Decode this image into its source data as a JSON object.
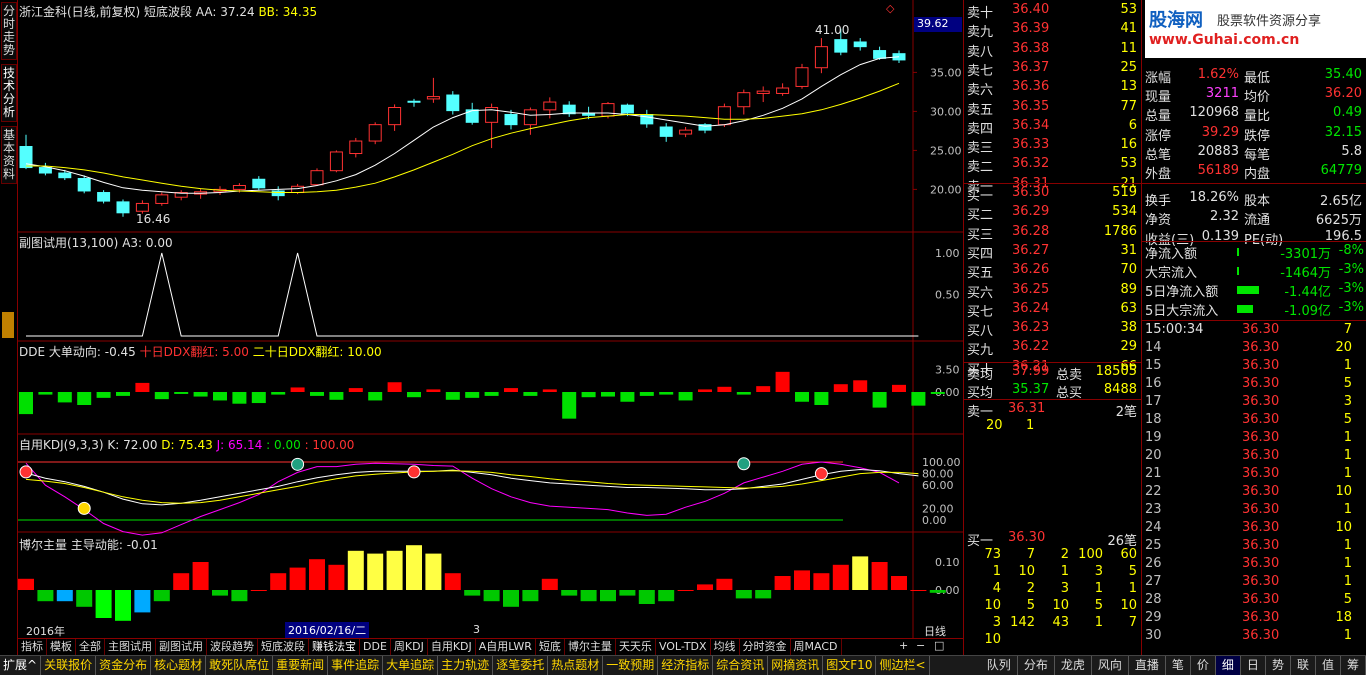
{
  "leftnav": [
    "分时走势",
    "技术分析",
    "基本资料"
  ],
  "main_title": {
    "stock": "浙江金科(日线,前复权)",
    "indicator": "短底波段",
    "aa": "AA: 37.24",
    "bb": "BB: 34.35"
  },
  "price_axis": [
    "35.00",
    "30.00",
    "25.00",
    "20.00"
  ],
  "price_marker": "39.62",
  "hi_label": "41.00",
  "lo_label": "16.46",
  "sub1": {
    "title": "副图试用(13,100)",
    "value": "A3: 0.00",
    "axis": [
      "1.00",
      "0.50"
    ]
  },
  "dde": {
    "title": "DDE 大单动向: -0.45",
    "t2": "十日DDX翻红: 5.00",
    "t3": "二十日DDX翻红: 10.00",
    "axis": [
      "3.50",
      "0.00"
    ]
  },
  "kdj": {
    "title": "自用KDJ(9,3,3)",
    "k": "K: 72.00",
    "d": "D: 75.43",
    "j": "J: 65.14",
    "z1": ": 0.00",
    "z2": ": 100.00",
    "axis": [
      "100.00",
      "80.00",
      "60.00",
      "20.00",
      "0.00"
    ]
  },
  "bor": {
    "title": "博尔主量",
    "value": "主导动能: -0.01",
    "axis": [
      "0.10",
      "0.00"
    ]
  },
  "dates": {
    "y": "2016年",
    "sel": "2016/02/16/二",
    "m": "3",
    "period": "日线"
  },
  "chart_data": {
    "type": "candlestick",
    "candles": [
      [
        25.5,
        27.0,
        22.6,
        22.8
      ],
      [
        22.8,
        23.4,
        21.8,
        22.1
      ],
      [
        22.1,
        22.5,
        21.2,
        21.5
      ],
      [
        21.4,
        21.8,
        19.5,
        19.8
      ],
      [
        19.6,
        19.9,
        18.2,
        18.5
      ],
      [
        18.4,
        18.7,
        16.5,
        17.0
      ],
      [
        17.2,
        18.6,
        16.9,
        18.2
      ],
      [
        18.2,
        19.6,
        17.9,
        19.3
      ],
      [
        19.0,
        19.9,
        18.6,
        19.6
      ],
      [
        19.4,
        20.1,
        18.8,
        19.7
      ],
      [
        19.7,
        20.4,
        19.3,
        20.0
      ],
      [
        20.0,
        20.8,
        19.6,
        20.5
      ],
      [
        21.3,
        21.7,
        19.9,
        20.2
      ],
      [
        19.8,
        20.4,
        18.6,
        19.2
      ],
      [
        19.6,
        20.7,
        19.4,
        20.4
      ],
      [
        20.6,
        22.7,
        20.5,
        22.4
      ],
      [
        22.4,
        25.0,
        22.2,
        24.8
      ],
      [
        24.6,
        26.6,
        24.1,
        26.2
      ],
      [
        26.2,
        28.6,
        25.8,
        28.3
      ],
      [
        28.3,
        30.9,
        27.5,
        30.5
      ],
      [
        31.3,
        31.6,
        30.6,
        31.2
      ],
      [
        31.6,
        34.3,
        31.1,
        31.9
      ],
      [
        32.1,
        32.6,
        29.6,
        30.1
      ],
      [
        30.2,
        31.1,
        28.3,
        28.6
      ],
      [
        28.6,
        31.0,
        25.3,
        30.5
      ],
      [
        29.6,
        30.2,
        27.7,
        28.3
      ],
      [
        28.3,
        30.5,
        27.0,
        30.2
      ],
      [
        30.2,
        31.8,
        29.1,
        31.2
      ],
      [
        30.8,
        31.3,
        29.3,
        29.7
      ],
      [
        29.7,
        30.6,
        29.0,
        29.5
      ],
      [
        29.4,
        31.2,
        29.1,
        31.0
      ],
      [
        30.8,
        31.0,
        29.4,
        29.8
      ],
      [
        29.6,
        30.2,
        27.9,
        28.4
      ],
      [
        28.0,
        28.5,
        26.1,
        26.8
      ],
      [
        27.1,
        28.0,
        26.7,
        27.6
      ],
      [
        28.3,
        28.5,
        27.2,
        27.6
      ],
      [
        28.3,
        31.0,
        28.0,
        30.6
      ],
      [
        30.6,
        32.8,
        29.6,
        32.4
      ],
      [
        32.3,
        33.2,
        31.2,
        32.6
      ],
      [
        32.3,
        33.6,
        32.0,
        33.0
      ],
      [
        33.2,
        36.1,
        32.9,
        35.6
      ],
      [
        35.6,
        39.4,
        34.9,
        38.3
      ],
      [
        39.2,
        40.6,
        37.2,
        37.6
      ],
      [
        38.9,
        39.4,
        37.8,
        38.3
      ],
      [
        37.8,
        38.3,
        36.6,
        36.8
      ],
      [
        37.4,
        37.8,
        36.2,
        36.6
      ]
    ],
    "ma_fast": [
      23.3,
      22.9,
      22.4,
      21.7,
      20.9,
      20.2,
      19.9,
      19.7,
      19.5,
      19.5,
      19.6,
      19.8,
      19.9,
      20.0,
      20.1,
      20.5,
      21.1,
      21.9,
      23.1,
      24.6,
      26.3,
      28.0,
      29.2,
      30.1,
      30.2,
      29.9,
      29.5,
      29.6,
      29.8,
      29.8,
      29.8,
      29.6,
      29.3,
      28.9,
      28.5,
      28.1,
      28.3,
      28.8,
      29.5,
      30.4,
      31.6,
      33.2,
      34.7,
      36.0,
      36.8,
      37.0
    ],
    "ma_slow": [
      23.0,
      23.0,
      22.8,
      22.5,
      22.1,
      21.6,
      21.2,
      20.8,
      20.4,
      20.1,
      19.9,
      19.8,
      19.7,
      19.6,
      19.6,
      19.7,
      19.9,
      20.3,
      20.8,
      21.6,
      22.5,
      23.5,
      24.5,
      25.6,
      26.5,
      27.2,
      27.8,
      28.3,
      28.8,
      29.2,
      29.4,
      29.6,
      29.6,
      29.5,
      29.4,
      29.2,
      29.0,
      29.0,
      29.1,
      29.4,
      29.7,
      30.2,
      30.9,
      31.7,
      32.6,
      33.6
    ],
    "sub1": [
      0,
      0,
      0,
      0,
      0,
      0,
      0,
      1,
      0,
      0,
      0,
      0,
      0,
      0,
      1,
      0,
      0,
      0,
      0,
      0,
      0,
      0,
      0,
      0,
      0,
      0,
      0,
      0,
      0,
      0,
      0,
      0,
      0,
      0,
      0,
      0,
      0,
      0,
      0,
      0,
      0,
      0,
      0,
      0,
      0,
      0,
      0
    ],
    "dde": [
      -3.4,
      -0.4,
      -1.6,
      -2.0,
      -0.9,
      -0.6,
      1.4,
      -1.1,
      -0.3,
      -0.7,
      -1.3,
      -1.8,
      -1.7,
      -0.4,
      0.7,
      -0.6,
      -1.2,
      0.6,
      -1.3,
      1.5,
      -0.8,
      0.4,
      -1.2,
      -0.9,
      -0.6,
      0.6,
      -0.6,
      0.4,
      -4.1,
      -0.8,
      -0.7,
      -1.5,
      -0.6,
      -0.4,
      -1.3,
      0.4,
      0.8,
      -0.4,
      0.9,
      3.1,
      -1.5,
      -2.0,
      1.2,
      1.8,
      -2.4,
      1.1,
      -2.1,
      -0.3
    ],
    "kdj_k": [
      81,
      72,
      66,
      58,
      48,
      36,
      28,
      26,
      29,
      34,
      40,
      46,
      52,
      58,
      66,
      73,
      78,
      82,
      84,
      84,
      84,
      84,
      86,
      82,
      78,
      72,
      68,
      64,
      62,
      60,
      58,
      56,
      56,
      55,
      54,
      52,
      52,
      54,
      58,
      62,
      70,
      78,
      84,
      87,
      85,
      80,
      76
    ],
    "kdj_d": [
      70,
      67,
      63,
      56,
      48,
      40,
      34,
      30,
      29,
      30,
      34,
      40,
      46,
      52,
      58,
      65,
      71,
      76,
      79,
      81,
      83,
      84,
      85,
      84,
      82,
      78,
      75,
      71,
      68,
      66,
      63,
      61,
      60,
      59,
      58,
      57,
      56,
      55,
      56,
      58,
      62,
      68,
      74,
      80,
      82,
      82,
      80
    ],
    "kdj_j": [
      98,
      60,
      40,
      18,
      -6,
      -20,
      -26,
      -22,
      -8,
      6,
      18,
      30,
      44,
      66,
      82,
      92,
      92,
      96,
      98,
      97,
      96,
      94,
      93,
      72,
      54,
      40,
      30,
      24,
      22,
      20,
      18,
      12,
      8,
      10,
      22,
      32,
      46,
      64,
      74,
      84,
      96,
      100,
      96,
      90,
      82,
      64
    ],
    "bor": [
      0.04,
      -0.04,
      -0.04,
      -0.06,
      -0.1,
      -0.11,
      -0.08,
      -0.04,
      0.06,
      0.1,
      -0.02,
      -0.04,
      0.0,
      0.06,
      0.08,
      0.11,
      0.09,
      0.14,
      0.13,
      0.14,
      0.16,
      0.13,
      0.06,
      -0.02,
      -0.04,
      -0.06,
      -0.04,
      0.04,
      -0.02,
      -0.04,
      -0.04,
      -0.02,
      -0.05,
      -0.04,
      0.0,
      0.02,
      0.04,
      -0.03,
      -0.03,
      0.05,
      0.07,
      0.06,
      0.09,
      0.12,
      0.1,
      0.05,
      0.0,
      -0.01
    ]
  },
  "asks": [
    {
      "label": "卖十",
      "price": "36.40",
      "vol": "53"
    },
    {
      "label": "卖九",
      "price": "36.39",
      "vol": "41"
    },
    {
      "label": "卖八",
      "price": "36.38",
      "vol": "11"
    },
    {
      "label": "卖七",
      "price": "36.37",
      "vol": "25"
    },
    {
      "label": "卖六",
      "price": "36.36",
      "vol": "13"
    },
    {
      "label": "卖五",
      "price": "36.35",
      "vol": "77"
    },
    {
      "label": "卖四",
      "price": "36.34",
      "vol": "6"
    },
    {
      "label": "卖三",
      "price": "36.33",
      "vol": "16"
    },
    {
      "label": "卖二",
      "price": "36.32",
      "vol": "53"
    },
    {
      "label": "卖一",
      "price": "36.31",
      "vol": "21"
    }
  ],
  "bids": [
    {
      "label": "买一",
      "price": "36.30",
      "vol": "519"
    },
    {
      "label": "买二",
      "price": "36.29",
      "vol": "534"
    },
    {
      "label": "买三",
      "price": "36.28",
      "vol": "1786"
    },
    {
      "label": "买四",
      "price": "36.27",
      "vol": "31"
    },
    {
      "label": "买五",
      "price": "36.26",
      "vol": "70"
    },
    {
      "label": "买六",
      "price": "36.25",
      "vol": "89"
    },
    {
      "label": "买七",
      "price": "36.24",
      "vol": "63"
    },
    {
      "label": "买八",
      "price": "36.23",
      "vol": "38"
    },
    {
      "label": "买九",
      "price": "36.22",
      "vol": "29"
    },
    {
      "label": "买十",
      "price": "36.21",
      "vol": "66"
    }
  ],
  "avg": {
    "sell_label": "卖均",
    "sell": "37.99",
    "sell_total_label": "总卖",
    "sell_total": "18505",
    "buy_label": "买均",
    "buy": "35.37",
    "buy_total_label": "总买",
    "buy_total": "8488"
  },
  "queue_sell": {
    "label": "卖一",
    "price": "36.31",
    "count": "2笔",
    "items": [
      "20",
      "1"
    ]
  },
  "queue_buy": {
    "label": "买一",
    "price": "36.30",
    "count": "26笔",
    "items": [
      "73",
      "7",
      "2",
      "100",
      "60",
      "1",
      "10",
      "1",
      "3",
      "5",
      "4",
      "2",
      "3",
      "1",
      "1",
      "10",
      "5",
      "10",
      "5",
      "10",
      "3",
      "142",
      "43",
      "1",
      "7",
      "10"
    ]
  },
  "stats": [
    {
      "l1": "涨幅",
      "v1": "1.62%",
      "l2": "最低",
      "v2": "35.40"
    },
    {
      "l1": "现量",
      "v1": "3211",
      "l2": "均价",
      "v2": "36.20"
    },
    {
      "l1": "总量",
      "v1": "120968",
      "l2": "量比",
      "v2": "0.49"
    },
    {
      "l1": "涨停",
      "v1": "39.29",
      "l2": "跌停",
      "v2": "32.15"
    },
    {
      "l1": "总笔",
      "v1": "20883",
      "l2": "每笔",
      "v2": "5.8"
    },
    {
      "l1": "外盘",
      "v1": "56189",
      "l2": "内盘",
      "v2": "64779"
    },
    {
      "l1": "换手",
      "v1": "18.26%",
      "l2": "股本",
      "v2": "2.65亿"
    },
    {
      "l1": "净资",
      "v1": "2.32",
      "l2": "流通",
      "v2": "6625万"
    },
    {
      "l1": "收益(三)",
      "v1": "0.139",
      "l2": "PE(动)",
      "v2": "196.5"
    }
  ],
  "flows": [
    {
      "label": "净流入额",
      "value": "-3301万",
      "pct": "-8%",
      "bar": 0.05
    },
    {
      "label": "大宗流入",
      "value": "-1464万",
      "pct": "-3%",
      "bar": 0.02
    },
    {
      "label": "5日净流入额",
      "value": "-1.44亿",
      "pct": "-3%",
      "bar": 0.55
    },
    {
      "label": "5日大宗流入",
      "value": "-1.09亿",
      "pct": "-3%",
      "bar": 0.4
    }
  ],
  "ticks": [
    {
      "t": "15:00:34",
      "p": "36.30",
      "v": "7"
    },
    {
      "t": "14",
      "p": "36.30",
      "v": "20"
    },
    {
      "t": "15",
      "p": "36.30",
      "v": "1"
    },
    {
      "t": "16",
      "p": "36.30",
      "v": "5"
    },
    {
      "t": "17",
      "p": "36.30",
      "v": "3"
    },
    {
      "t": "18",
      "p": "36.30",
      "v": "5"
    },
    {
      "t": "19",
      "p": "36.30",
      "v": "1"
    },
    {
      "t": "20",
      "p": "36.30",
      "v": "1"
    },
    {
      "t": "21",
      "p": "36.30",
      "v": "1"
    },
    {
      "t": "22",
      "p": "36.30",
      "v": "10"
    },
    {
      "t": "23",
      "p": "36.30",
      "v": "1"
    },
    {
      "t": "24",
      "p": "36.30",
      "v": "10"
    },
    {
      "t": "25",
      "p": "36.30",
      "v": "1"
    },
    {
      "t": "26",
      "p": "36.30",
      "v": "1"
    },
    {
      "t": "27",
      "p": "36.30",
      "v": "1"
    },
    {
      "t": "28",
      "p": "36.30",
      "v": "5"
    },
    {
      "t": "29",
      "p": "36.30",
      "v": "18"
    },
    {
      "t": "30",
      "p": "36.30",
      "v": "1"
    }
  ],
  "logo": {
    "name": "股海网",
    "slogan": "股票软件资源分享",
    "url": "www.Guhai.com.cn"
  },
  "tabs": [
    "指标",
    "模板",
    "全部",
    "主图试用",
    "副图试用",
    "波段趋势",
    "短底波段",
    "赚钱法宝",
    "DDE",
    "周KDJ",
    "自用KDJ",
    "A自用LWR",
    "短底",
    "博尔主量",
    "天天乐",
    "VOL-TDX",
    "均线",
    "分时资金",
    "周MACD"
  ],
  "tab_active_index": 7,
  "bottom_tabs": [
    "扩展^",
    "关联报价",
    "资金分布",
    "核心题材",
    "敢死队席位",
    "重要新闻",
    "事件追踪",
    "大单追踪",
    "主力轨迹",
    "逐笔委托",
    "热点题材",
    "一致预期",
    "经济指标",
    "综合资讯",
    "网摘资讯",
    "图文F10",
    "侧边栏<"
  ],
  "right_tabs": [
    "队列",
    "分布",
    "龙虎",
    "风向",
    "直播",
    "笔",
    "价",
    "细",
    "日",
    "势",
    "联",
    "值",
    "筹"
  ],
  "right_tab_selected": 7
}
